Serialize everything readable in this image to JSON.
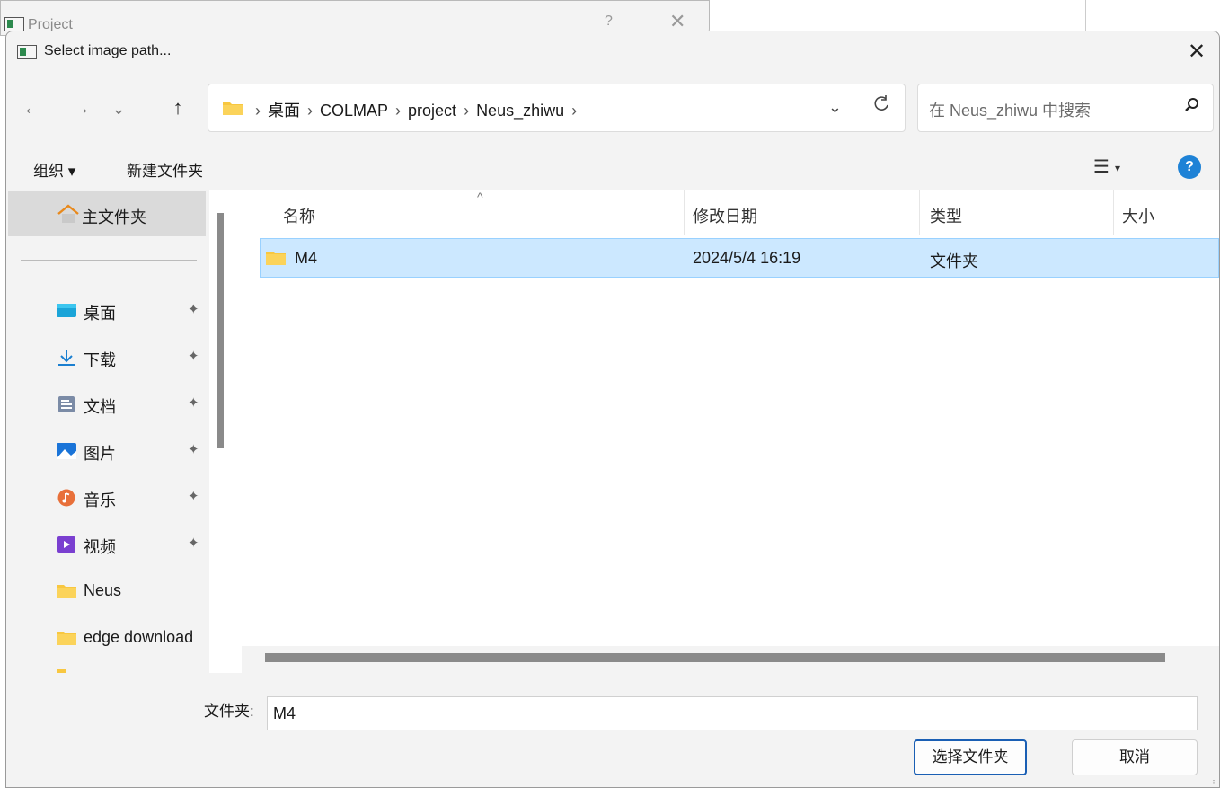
{
  "background_window": {
    "title": "Project",
    "help": "?",
    "close": "✕"
  },
  "dialog": {
    "title": "Select image path...",
    "close": "✕"
  },
  "nav": {
    "back": "←",
    "forward": "→",
    "recent": "⌄",
    "up": "↑"
  },
  "address": {
    "crumbs": [
      "桌面",
      "COLMAP",
      "project",
      "Neus_zhiwu"
    ],
    "separator": "›",
    "dropdown": "⌄",
    "refresh": "C"
  },
  "search": {
    "placeholder": "在 Neus_zhiwu 中搜索",
    "icon": "search-icon"
  },
  "toolbar": {
    "organize": "组织 ▾",
    "new_folder": "新建文件夹",
    "view": "☰",
    "view_caret": "▾",
    "help": "?"
  },
  "sidebar": {
    "home": "主文件夹",
    "items": [
      {
        "label": "桌面",
        "icon": "desktop-icon",
        "pinned": true
      },
      {
        "label": "下载",
        "icon": "download-icon",
        "pinned": true
      },
      {
        "label": "文档",
        "icon": "document-icon",
        "pinned": true
      },
      {
        "label": "图片",
        "icon": "pictures-icon",
        "pinned": true
      },
      {
        "label": "音乐",
        "icon": "music-icon",
        "pinned": true
      },
      {
        "label": "视频",
        "icon": "video-icon",
        "pinned": true
      },
      {
        "label": "Neus",
        "icon": "folder-icon",
        "pinned": false
      },
      {
        "label": "edge download",
        "icon": "folder-icon",
        "pinned": false
      }
    ],
    "pin_glyph": "📌"
  },
  "columns": {
    "name": "名称",
    "modified": "修改日期",
    "type": "类型",
    "size": "大小",
    "sort_caret": "^"
  },
  "files": [
    {
      "name": "M4",
      "modified": "2024/5/4 16:19",
      "type": "文件夹",
      "size": ""
    }
  ],
  "footer": {
    "folder_label": "文件夹:",
    "folder_value": "M4",
    "select_button": "选择文件夹",
    "cancel_button": "取消"
  },
  "colors": {
    "selection": "#cce8ff",
    "accent": "#1a5fb4",
    "folder": "#f8c740"
  }
}
